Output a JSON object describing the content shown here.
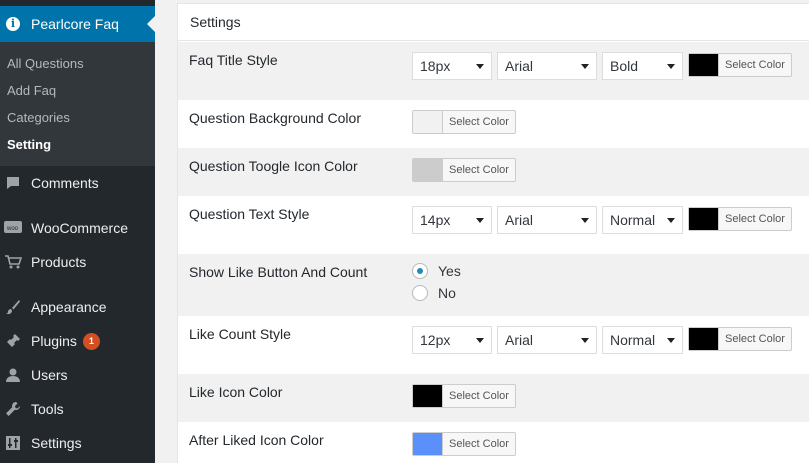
{
  "sidebar": {
    "current": "Pearlcore Faq",
    "submenu": [
      "All Questions",
      "Add Faq",
      "Categories",
      "Setting"
    ],
    "items": [
      {
        "label": "Comments"
      },
      {
        "label": "WooCommerce"
      },
      {
        "label": "Products"
      },
      {
        "label": "Appearance"
      },
      {
        "label": "Plugins",
        "badge": "1"
      },
      {
        "label": "Users"
      },
      {
        "label": "Tools"
      },
      {
        "label": "Settings"
      }
    ]
  },
  "panel": {
    "title": "Settings"
  },
  "select_color_label": "Select Color",
  "rows": {
    "faq_title_style": {
      "label": "Faq Title Style",
      "size": "18px",
      "font": "Arial",
      "weight": "Bold",
      "color": "#000000"
    },
    "question_bg": {
      "label": "Question Background Color",
      "color": "#f1f1f1"
    },
    "question_toggle": {
      "label": "Question Toogle Icon Color",
      "color": "#cccccc"
    },
    "question_text": {
      "label": "Question Text Style",
      "size": "14px",
      "font": "Arial",
      "weight": "Normal",
      "color": "#000000"
    },
    "show_like": {
      "label": "Show Like Button And Count",
      "yes": "Yes",
      "no": "No",
      "selected": "Yes"
    },
    "like_count": {
      "label": "Like Count Style",
      "size": "12px",
      "font": "Arial",
      "weight": "Normal",
      "color": "#000000"
    },
    "like_icon": {
      "label": "Like Icon Color",
      "color": "#000000"
    },
    "after_liked": {
      "label": "After Liked Icon Color",
      "color": "#5b8ff9"
    }
  }
}
